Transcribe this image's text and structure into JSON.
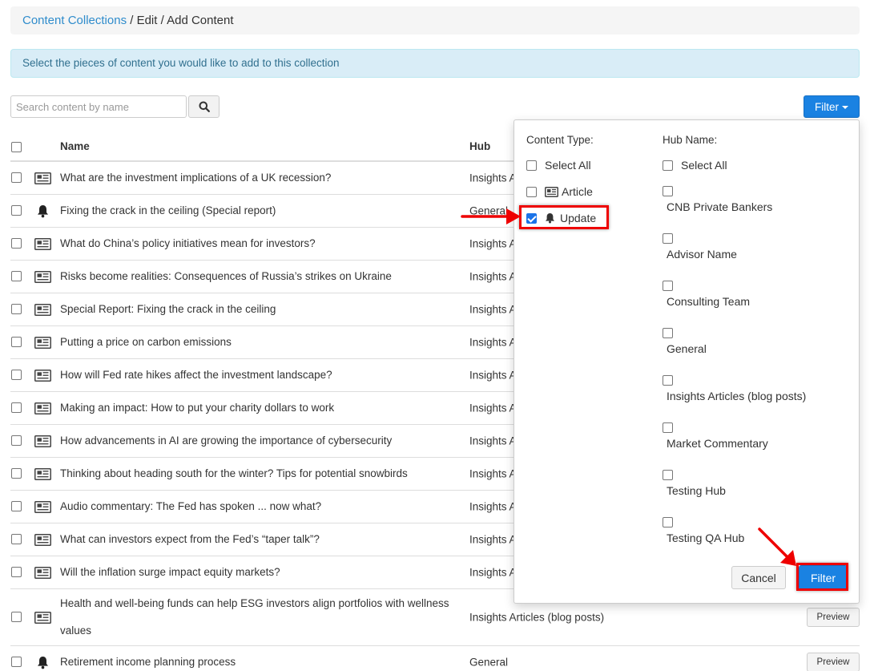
{
  "breadcrumb": {
    "link": "Content Collections",
    "rest": " / Edit / Add Content"
  },
  "info_text": "Select the pieces of content you would like to add to this collection",
  "search": {
    "placeholder": "Search content by name"
  },
  "filter_button": "Filter",
  "table": {
    "headers": {
      "name": "Name",
      "hub": "Hub"
    },
    "rows": [
      {
        "icon": "article-icon",
        "name": "What are the investment implications of a UK recession?",
        "hub": "Insights A"
      },
      {
        "icon": "bell-icon",
        "name": "Fixing the crack in the ceiling (Special report)",
        "hub": "General"
      },
      {
        "icon": "article-icon",
        "name": "What do China’s policy initiatives mean for investors?",
        "hub": "Insights A"
      },
      {
        "icon": "article-icon",
        "name": "Risks become realities: Consequences of Russia’s strikes on Ukraine",
        "hub": "Insights A"
      },
      {
        "icon": "article-icon",
        "name": "Special Report: Fixing the crack in the ceiling",
        "hub": "Insights A"
      },
      {
        "icon": "article-icon",
        "name": "Putting a price on carbon emissions",
        "hub": "Insights A"
      },
      {
        "icon": "article-icon",
        "name": "How will Fed rate hikes affect the investment landscape?",
        "hub": "Insights A"
      },
      {
        "icon": "article-icon",
        "name": "Making an impact: How to put your charity dollars to work",
        "hub": "Insights A"
      },
      {
        "icon": "article-icon",
        "name": "How advancements in AI are growing the importance of cybersecurity",
        "hub": "Insights A"
      },
      {
        "icon": "article-icon",
        "name": "Thinking about heading south for the winter? Tips for potential snowbirds",
        "hub": "Insights A"
      },
      {
        "icon": "article-icon",
        "name": "Audio commentary: The Fed has spoken ... now what?",
        "hub": "Insights A"
      },
      {
        "icon": "article-icon",
        "name": "What can investors expect from the Fed’s “taper talk”?",
        "hub": "Insights A"
      },
      {
        "icon": "article-icon",
        "name": "Will the inflation surge impact equity markets?",
        "hub": "Insights A"
      },
      {
        "icon": "article-icon",
        "name": "Health and well-being funds can help ESG investors align portfolios with wellness values",
        "hub": "Insights Articles (blog posts)",
        "preview": "Preview"
      },
      {
        "icon": "bell-icon",
        "name": "Retirement income planning process",
        "hub": "General",
        "preview": "Preview"
      }
    ]
  },
  "filter_popup": {
    "content_type_title": "Content Type:",
    "content_types": [
      {
        "label": "Select All",
        "checked": false,
        "icon": ""
      },
      {
        "label": "Article",
        "checked": false,
        "icon": "article-icon"
      },
      {
        "label": "Update",
        "checked": true,
        "icon": "bell-icon"
      }
    ],
    "hub_name_title": "Hub Name:",
    "hub_select_all": "Select All",
    "hubs": [
      "CNB Private Bankers",
      "Advisor Name",
      "Consulting Team",
      "General",
      "Insights Articles (blog posts)",
      "Market Commentary",
      "Testing Hub",
      "Testing QA Hub"
    ],
    "cancel_label": "Cancel",
    "filter_label": "Filter"
  },
  "colors": {
    "primary": "#1a82e2",
    "link": "#2f8ccc",
    "info_bg": "#d9edf7",
    "highlight": "#ee0000"
  }
}
